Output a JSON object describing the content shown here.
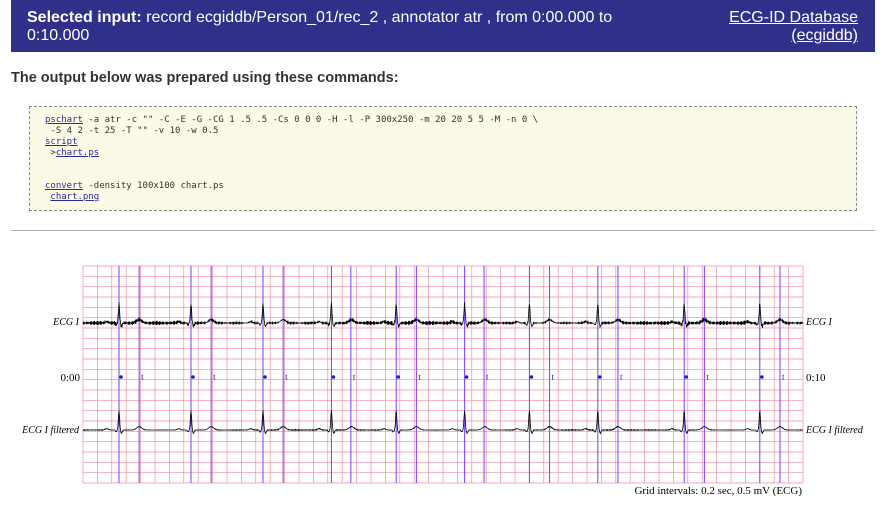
{
  "header": {
    "selected_label": "Selected input:",
    "selected_text": "record ecgiddb/Person_01/rec_2 , annotator atr , from 0:00.000 to 0:10.000",
    "db_name": "ECG-ID Database",
    "db_id": "(ecgiddb)"
  },
  "output_heading": "The output below was prepared using these commands:",
  "commands": {
    "line1_link": "pschart",
    "line1_rest": " -a atr -c \"\" -C -E -G -CG 1 .5 .5 -Cs 0 0 0 -H -l -P 300x250 -m 20 20 5 5 -M -n 0 \\",
    "line2": " -S 4 2 -t 25 -T \"\" -v 10 -w 0.5",
    "line3_link": "script",
    "line4_prefix": " >",
    "line4_link": "chart.ps",
    "line7_link": "convert",
    "line7_rest": " -density 100x100 chart.ps",
    "line8_prefix": " ",
    "line8_link": "chart.png"
  },
  "chart": {
    "signal1_left": "ECG I",
    "signal1_right": "ECG I",
    "time_start": "0:00",
    "time_end": "0:10",
    "signal2_left": "ECG I filtered",
    "signal2_right": "ECG I filtered",
    "footer": "Grid intervals: 0.2 sec, 0.5 mV (ECG)",
    "grid_color": "#f08aa6",
    "marker_color": "#7a3cff",
    "annotation_color": "#2020c0"
  },
  "chart_data": {
    "type": "line",
    "xlim": [
      0,
      10
    ],
    "grid": true,
    "beats_sec": [
      0.5,
      1.5,
      2.5,
      3.45,
      4.35,
      5.3,
      6.2,
      7.15,
      8.35,
      9.4
    ],
    "t_waves_sec": [
      0.78,
      1.78,
      2.78,
      3.72,
      4.63,
      5.57,
      6.48,
      7.43,
      8.63,
      9.68
    ]
  }
}
